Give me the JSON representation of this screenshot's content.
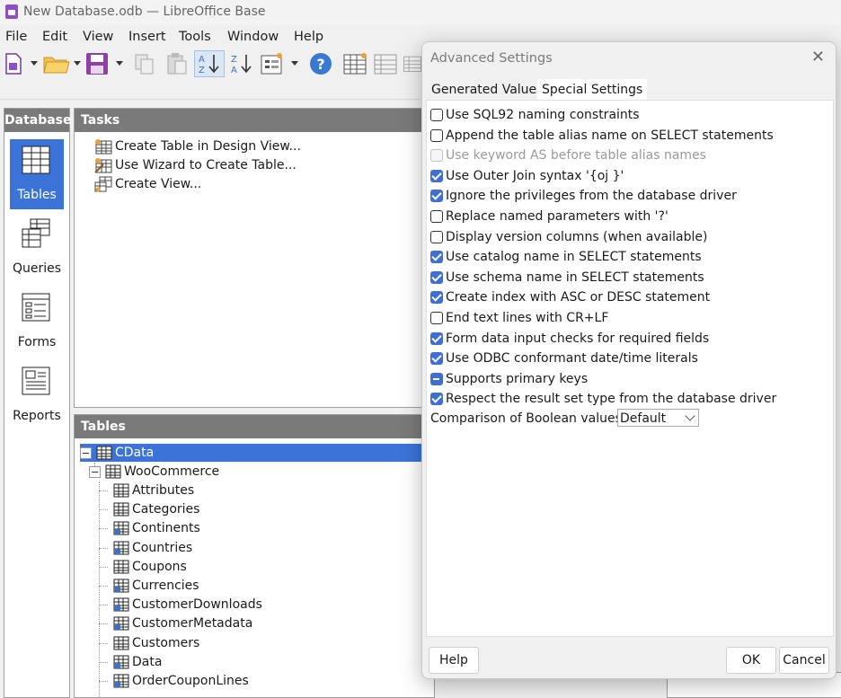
{
  "window": {
    "title": "New Database.odb — LibreOffice Base"
  },
  "menu": [
    "File",
    "Edit",
    "View",
    "Insert",
    "Tools",
    "Window",
    "Help"
  ],
  "toolbar": {
    "icons": [
      "new-document-icon",
      "open-folder-icon",
      "save-icon",
      "copy-icon",
      "paste-icon",
      "sort-ascending-icon",
      "sort-descending-icon",
      "form-icon",
      "help-icon",
      "table-view-icon",
      "table-icon",
      "table-icon"
    ]
  },
  "sidebar": {
    "header": "Database",
    "items": [
      {
        "label": "Tables",
        "selected": true
      },
      {
        "label": "Queries",
        "selected": false
      },
      {
        "label": "Forms",
        "selected": false
      },
      {
        "label": "Reports",
        "selected": false
      }
    ]
  },
  "tasks": {
    "header": "Tasks",
    "items": [
      "Create Table in Design View...",
      "Use Wizard to Create Table...",
      "Create View..."
    ]
  },
  "tables": {
    "header": "Tables",
    "root": "CData",
    "schema": "WooCommerce",
    "items": [
      "Attributes",
      "Categories",
      "Continents",
      "Countries",
      "Coupons",
      "Currencies",
      "CustomerDownloads",
      "CustomerMetadata",
      "Customers",
      "Data",
      "OrderCouponLines"
    ]
  },
  "dialog": {
    "title": "Advanced Settings",
    "tabs": [
      "Generated Values",
      "Special Settings"
    ],
    "active_tab": "Special Settings",
    "options": [
      {
        "label": "Use SQL92 naming constraints",
        "state": "unchecked"
      },
      {
        "label": "Append the table alias name on SELECT statements",
        "state": "unchecked"
      },
      {
        "label": "Use keyword AS before table alias names",
        "state": "disabled"
      },
      {
        "label": "Use Outer Join syntax '{oj }'",
        "state": "checked"
      },
      {
        "label": "Ignore the privileges from the database driver",
        "state": "checked"
      },
      {
        "label": "Replace named parameters with '?'",
        "state": "unchecked"
      },
      {
        "label": "Display version columns (when available)",
        "state": "unchecked"
      },
      {
        "label": "Use catalog name in SELECT statements",
        "state": "checked"
      },
      {
        "label": "Use schema name in SELECT statements",
        "state": "checked"
      },
      {
        "label": "Create index with ASC or DESC statement",
        "state": "checked"
      },
      {
        "label": "End text lines with CR+LF",
        "state": "unchecked"
      },
      {
        "label": "Form data input checks for required fields",
        "state": "checked"
      },
      {
        "label": "Use ODBC conformant date/time literals",
        "state": "checked"
      },
      {
        "label": "Supports primary keys",
        "state": "mixed"
      },
      {
        "label": "Respect the result set type from the database driver",
        "state": "checked"
      }
    ],
    "boolean_label": "Comparison of Boolean values:",
    "boolean_value": "Default",
    "buttons": {
      "help": "Help",
      "ok": "OK",
      "cancel": "Cancel"
    }
  }
}
